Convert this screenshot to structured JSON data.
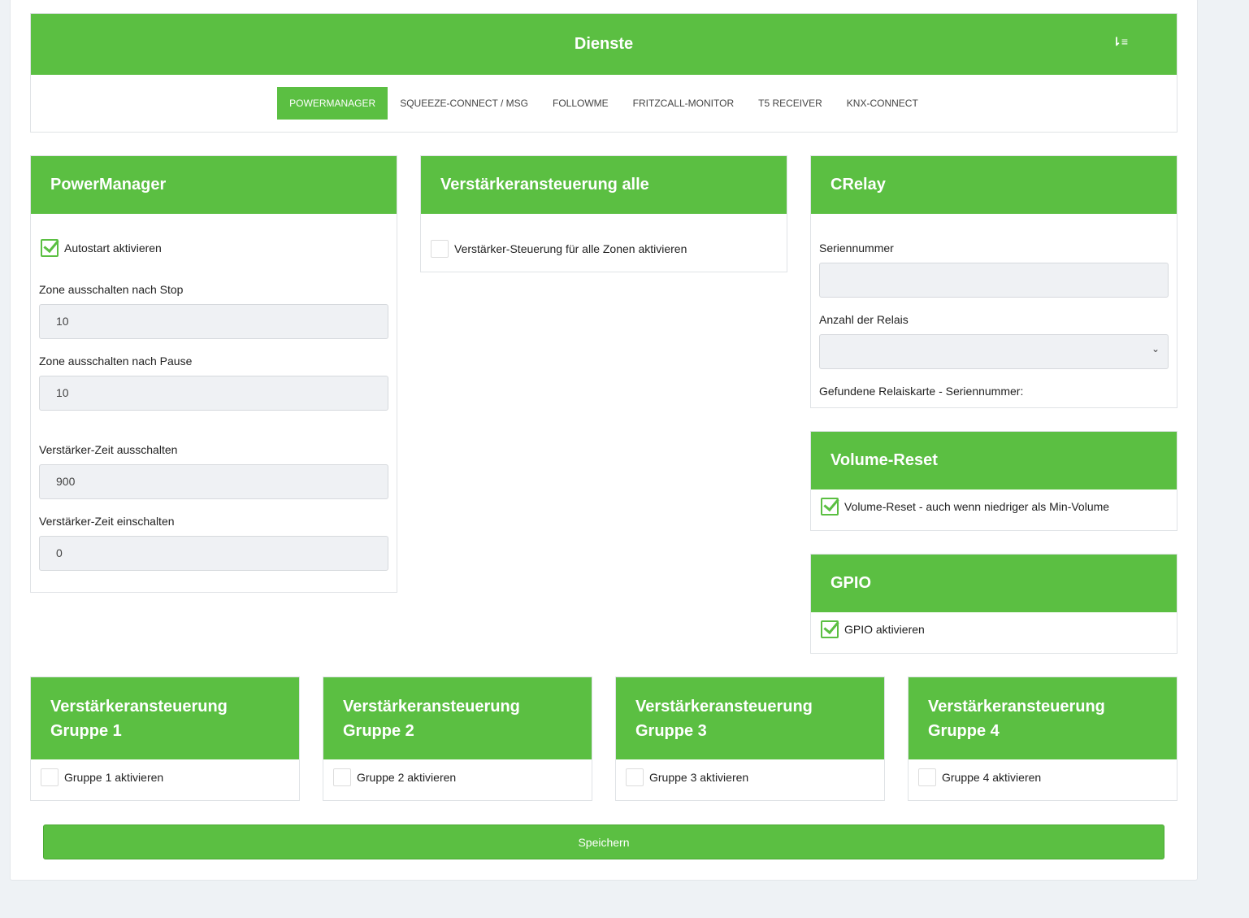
{
  "header": {
    "title": "Dienste",
    "sort_icon": "sort-icon"
  },
  "tabs": [
    {
      "label": "POWERMANAGER"
    },
    {
      "label": "SQUEEZE-CONNECT / MSG"
    },
    {
      "label": "FOLLOWME"
    },
    {
      "label": "FRITZCALL-MONITOR"
    },
    {
      "label": "T5 RECEIVER"
    },
    {
      "label": "KNX-CONNECT"
    }
  ],
  "powermanager": {
    "title": "PowerManager",
    "autostart": "Autostart aktivieren",
    "stop_label": "Zone ausschalten nach Stop",
    "stop_value": "10",
    "pause_label": "Zone ausschalten nach Pause",
    "pause_value": "10",
    "amp_off_label": "Verstärker-Zeit ausschalten",
    "amp_off_value": "900",
    "amp_on_label": "Verstärker-Zeit einschalten",
    "amp_on_value": "0"
  },
  "amp_all": {
    "title": "Verstärkeransteuerung alle",
    "checkbox": "Verstärker-Steuerung für alle Zonen aktivieren"
  },
  "crelay": {
    "title": "CRelay",
    "serial_label": "Seriennummer",
    "serial_value": "",
    "relays_label": "Anzahl der Relais",
    "found_label": "Gefundene Relaiskarte - Seriennummer:"
  },
  "volume_reset": {
    "title": "Volume-Reset",
    "checkbox": "Volume-Reset - auch wenn niedriger als Min-Volume"
  },
  "gpio": {
    "title": "GPIO",
    "checkbox": "GPIO aktivieren"
  },
  "groups": [
    {
      "title1": "Verstärkeransteuerung",
      "title2": "Gruppe 1",
      "checkbox": "Gruppe 1 aktivieren"
    },
    {
      "title1": "Verstärkeransteuerung",
      "title2": "Gruppe 2",
      "checkbox": "Gruppe 2 aktivieren"
    },
    {
      "title1": "Verstärkeransteuerung",
      "title2": "Gruppe 3",
      "checkbox": "Gruppe 3 aktivieren"
    },
    {
      "title1": "Verstärkeransteuerung",
      "title2": "Gruppe 4",
      "checkbox": "Gruppe 4 aktivieren"
    }
  ],
  "save_label": "Speichern",
  "colors": {
    "accent": "#5bbf42"
  }
}
